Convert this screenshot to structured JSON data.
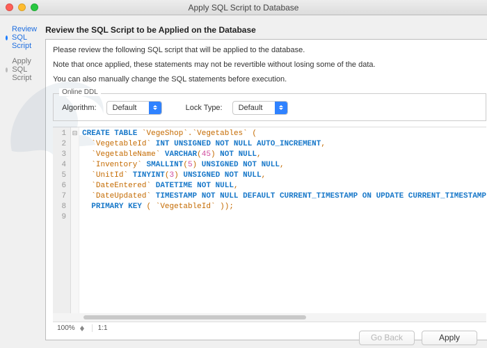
{
  "window": {
    "title": "Apply SQL Script to Database"
  },
  "sidebar": {
    "steps": [
      {
        "label": "Review SQL Script",
        "active": true
      },
      {
        "label": "Apply SQL Script",
        "active": false
      }
    ]
  },
  "panel": {
    "title": "Review the SQL Script to be Applied on the Database",
    "instructions": [
      "Please review the following SQL script that will be applied to the database.",
      "Note that once applied, these statements may not be revertible without losing some of the data.",
      "You can also manually change the SQL statements before execution."
    ],
    "ddl": {
      "legend": "Online DDL",
      "algorithm_label": "Algorithm:",
      "algorithm_value": "Default",
      "lock_label": "Lock Type:",
      "lock_value": "Default"
    }
  },
  "editor": {
    "line_count": 9,
    "zoom": "100%",
    "ratio": "1:1",
    "sql_tokens": [
      [
        {
          "t": "kw",
          "v": "CREATE TABLE"
        },
        {
          "t": "sp",
          "v": " "
        },
        {
          "t": "id",
          "v": "`VegeShop`"
        },
        {
          "t": "op",
          "v": "."
        },
        {
          "t": "id",
          "v": "`Vegetables`"
        },
        {
          "t": "sp",
          "v": " "
        },
        {
          "t": "op",
          "v": "("
        }
      ],
      [
        {
          "t": "sp",
          "v": "  "
        },
        {
          "t": "id",
          "v": "`VegetableId`"
        },
        {
          "t": "sp",
          "v": " "
        },
        {
          "t": "kw",
          "v": "INT UNSIGNED NOT NULL AUTO_INCREMENT"
        },
        {
          "t": "op",
          "v": ","
        }
      ],
      [
        {
          "t": "sp",
          "v": "  "
        },
        {
          "t": "id",
          "v": "`VegetableName`"
        },
        {
          "t": "sp",
          "v": " "
        },
        {
          "t": "kw",
          "v": "VARCHAR"
        },
        {
          "t": "op",
          "v": "("
        },
        {
          "t": "num",
          "v": "45"
        },
        {
          "t": "op",
          "v": ")"
        },
        {
          "t": "sp",
          "v": " "
        },
        {
          "t": "kw",
          "v": "NOT NULL"
        },
        {
          "t": "op",
          "v": ","
        }
      ],
      [
        {
          "t": "sp",
          "v": "  "
        },
        {
          "t": "id",
          "v": "`Inventory`"
        },
        {
          "t": "sp",
          "v": " "
        },
        {
          "t": "kw",
          "v": "SMALLINT"
        },
        {
          "t": "op",
          "v": "("
        },
        {
          "t": "num",
          "v": "5"
        },
        {
          "t": "op",
          "v": ")"
        },
        {
          "t": "sp",
          "v": " "
        },
        {
          "t": "kw",
          "v": "UNSIGNED NOT NULL"
        },
        {
          "t": "op",
          "v": ","
        }
      ],
      [
        {
          "t": "sp",
          "v": "  "
        },
        {
          "t": "id",
          "v": "`UnitId`"
        },
        {
          "t": "sp",
          "v": " "
        },
        {
          "t": "kw",
          "v": "TINYINT"
        },
        {
          "t": "op",
          "v": "("
        },
        {
          "t": "num",
          "v": "3"
        },
        {
          "t": "op",
          "v": ")"
        },
        {
          "t": "sp",
          "v": " "
        },
        {
          "t": "kw",
          "v": "UNSIGNED NOT NULL"
        },
        {
          "t": "op",
          "v": ","
        }
      ],
      [
        {
          "t": "sp",
          "v": "  "
        },
        {
          "t": "id",
          "v": "`DateEntered`"
        },
        {
          "t": "sp",
          "v": " "
        },
        {
          "t": "kw",
          "v": "DATETIME NOT NULL"
        },
        {
          "t": "op",
          "v": ","
        }
      ],
      [
        {
          "t": "sp",
          "v": "  "
        },
        {
          "t": "id",
          "v": "`DateUpdated`"
        },
        {
          "t": "sp",
          "v": " "
        },
        {
          "t": "kw",
          "v": "TIMESTAMP NOT NULL DEFAULT CURRENT_TIMESTAMP ON UPDATE CURRENT_TIMESTAMP"
        }
      ],
      [
        {
          "t": "sp",
          "v": "  "
        },
        {
          "t": "kw",
          "v": "PRIMARY KEY"
        },
        {
          "t": "sp",
          "v": " "
        },
        {
          "t": "op",
          "v": "("
        },
        {
          "t": "sp",
          "v": " "
        },
        {
          "t": "id",
          "v": "`VegetableId`"
        },
        {
          "t": "sp",
          "v": " "
        },
        {
          "t": "op",
          "v": ")"
        },
        {
          "t": "op",
          "v": ")"
        },
        {
          "t": "op",
          "v": ";"
        }
      ],
      []
    ]
  },
  "footer": {
    "go_back": "Go Back",
    "apply": "Apply"
  }
}
